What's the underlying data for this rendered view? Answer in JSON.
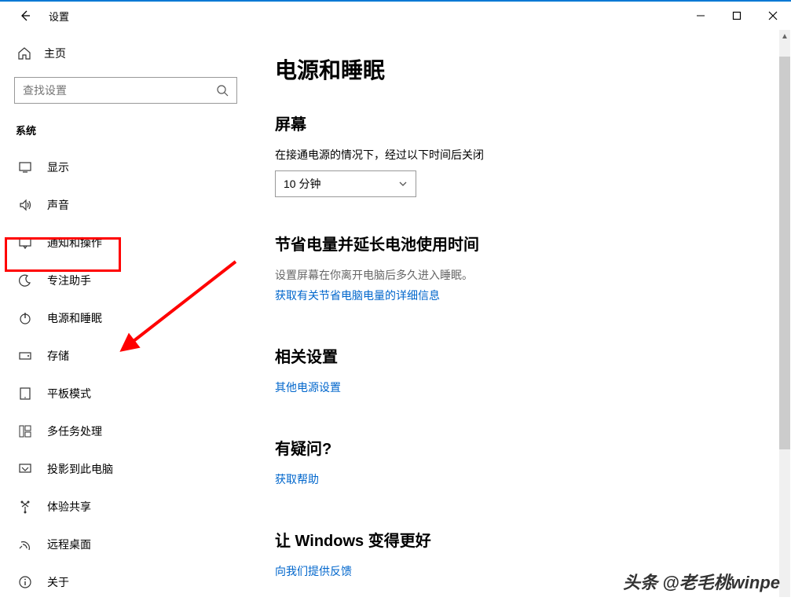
{
  "titlebar": {
    "title": "设置"
  },
  "sidebar": {
    "home": "主页",
    "search_placeholder": "查找设置",
    "section": "系统",
    "items": [
      {
        "label": "显示"
      },
      {
        "label": "声音"
      },
      {
        "label": "通知和操作"
      },
      {
        "label": "专注助手"
      },
      {
        "label": "电源和睡眠"
      },
      {
        "label": "存储"
      },
      {
        "label": "平板模式"
      },
      {
        "label": "多任务处理"
      },
      {
        "label": "投影到此电脑"
      },
      {
        "label": "体验共享"
      },
      {
        "label": "远程桌面"
      },
      {
        "label": "关于"
      }
    ]
  },
  "content": {
    "page_title": "电源和睡眠",
    "screen": {
      "heading": "屏幕",
      "label": "在接通电源的情况下，经过以下时间后关闭",
      "value": "10 分钟"
    },
    "battery": {
      "heading": "节省电量并延长电池使用时间",
      "desc": "设置屏幕在你离开电脑后多久进入睡眠。",
      "link": "获取有关节省电脑电量的详细信息"
    },
    "related": {
      "heading": "相关设置",
      "link": "其他电源设置"
    },
    "question": {
      "heading": "有疑问?",
      "link": "获取帮助"
    },
    "improve": {
      "heading": "让 Windows 变得更好",
      "link": "向我们提供反馈"
    }
  },
  "watermark": "头条 @老毛桃winpe"
}
